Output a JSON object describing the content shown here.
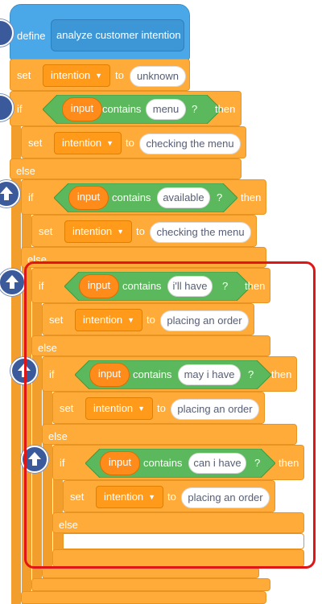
{
  "define_block": {
    "keyword": "define",
    "name": "analyze customer intention"
  },
  "set_top": {
    "keyword": "set",
    "variable": "intention",
    "to": "to",
    "value": "unknown"
  },
  "if1": {
    "keyword": "if",
    "input": "input",
    "operator": "contains",
    "query": "menu",
    "q": "?",
    "then": "then",
    "set": {
      "keyword": "set",
      "variable": "intention",
      "to": "to",
      "value": "checking the menu"
    },
    "else": "else"
  },
  "if2": {
    "keyword": "if",
    "input": "input",
    "operator": "contains",
    "query": "available",
    "q": "?",
    "then": "then",
    "set": {
      "keyword": "set",
      "variable": "intention",
      "to": "to",
      "value": "checking the menu"
    },
    "else": "else"
  },
  "if3": {
    "keyword": "if",
    "input": "input",
    "operator": "contains",
    "query": "i'll have",
    "q": "?",
    "then": "then",
    "set": {
      "keyword": "set",
      "variable": "intention",
      "to": "to",
      "value": "placing an order"
    },
    "else": "else"
  },
  "if4": {
    "keyword": "if",
    "input": "input",
    "operator": "contains",
    "query": "may i have",
    "q": "?",
    "then": "then",
    "set": {
      "keyword": "set",
      "variable": "intention",
      "to": "to",
      "value": "placing an order"
    },
    "else": "else"
  },
  "if5": {
    "keyword": "if",
    "input": "input",
    "operator": "contains",
    "query": "can i have",
    "q": "?",
    "then": "then",
    "set": {
      "keyword": "set",
      "variable": "intention",
      "to": "to",
      "value": "placing an order"
    },
    "else": "else"
  },
  "colors": {
    "control": "#ffab3a",
    "operator": "#5cb85c",
    "sensing": "#5cb1d6",
    "define": "#4aa8e8",
    "highlight": "#e01616",
    "collapse_button": "#3a5a9c"
  },
  "icons": [
    "collapse-arrow-icon",
    "dropdown-caret-icon"
  ]
}
